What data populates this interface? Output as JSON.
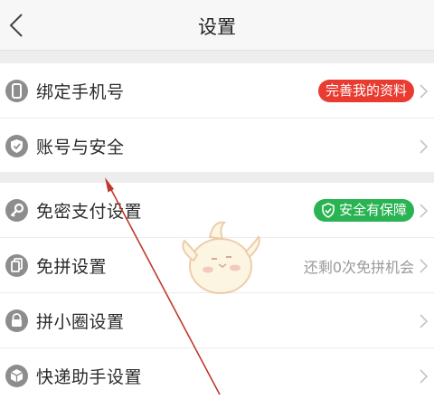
{
  "header": {
    "title": "设置",
    "back_icon": "chevron-left-icon"
  },
  "group1": [
    {
      "label": "绑定手机号",
      "icon": "phone-icon",
      "badge": "完善我的资料",
      "badge_color": "#e93b30"
    },
    {
      "label": "账号与安全",
      "icon": "shield-icon"
    }
  ],
  "group2": [
    {
      "label": "免密支付设置",
      "icon": "key-icon",
      "badge": "安全有保障",
      "badge_color": "#2ab352"
    },
    {
      "label": "免拼设置",
      "icon": "copy-icon",
      "note": "还剩0次免拼机会"
    },
    {
      "label": "拼小圈设置",
      "icon": "lock-icon"
    },
    {
      "label": "快递助手设置",
      "icon": "package-icon"
    }
  ],
  "colors": {
    "accent_red": "#e93b30",
    "accent_green": "#2ab352",
    "icon_gray": "#8d8d8d",
    "annotation_arrow": "#c0392b"
  }
}
